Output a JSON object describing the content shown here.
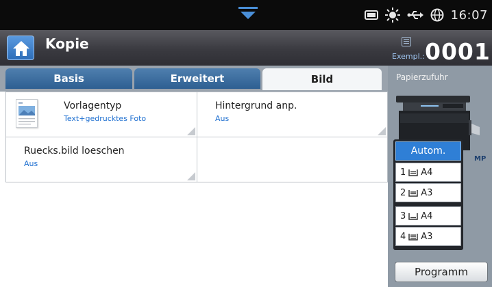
{
  "status": {
    "time": "16:07",
    "icons": [
      "notification-tray-arrow-icon",
      "memory-card-icon",
      "eco-sun-icon",
      "usb-icon",
      "network-globe-icon"
    ]
  },
  "header": {
    "title": "Kopie",
    "copies_label": "Exempl.:",
    "copies_count": "0001"
  },
  "tabs": [
    {
      "label": "Basis",
      "active": false
    },
    {
      "label": "Erweitert",
      "active": false
    },
    {
      "label": "Bild",
      "active": true
    }
  ],
  "options": [
    {
      "title": "Vorlagentyp",
      "value": "Text+gedrucktes Foto"
    },
    {
      "title": "Hintergrund anp.",
      "value": "Aus"
    },
    {
      "title": "Ruecks.bild loeschen",
      "value": "Aus"
    },
    {
      "title": "",
      "value": ""
    }
  ],
  "paper_supply": {
    "title": "Papierzufuhr",
    "mp_label": "MP",
    "trays": [
      {
        "label": "Autom.",
        "selected": true
      },
      {
        "number": "1",
        "size": "A4",
        "icon": "paper-stack-icon"
      },
      {
        "number": "2",
        "size": "A3",
        "icon": "paper-stack-icon"
      },
      {
        "number": "3",
        "size": "A4",
        "icon": "paper-low-icon"
      },
      {
        "number": "4",
        "size": "A3",
        "icon": "paper-stack-icon"
      }
    ]
  },
  "program_button": "Programm",
  "colors": {
    "accent_blue": "#2f7fd6",
    "value_text": "#1e6fd0",
    "panel": "#8f9aa5",
    "tab_inactive": "#3d6e9f"
  }
}
